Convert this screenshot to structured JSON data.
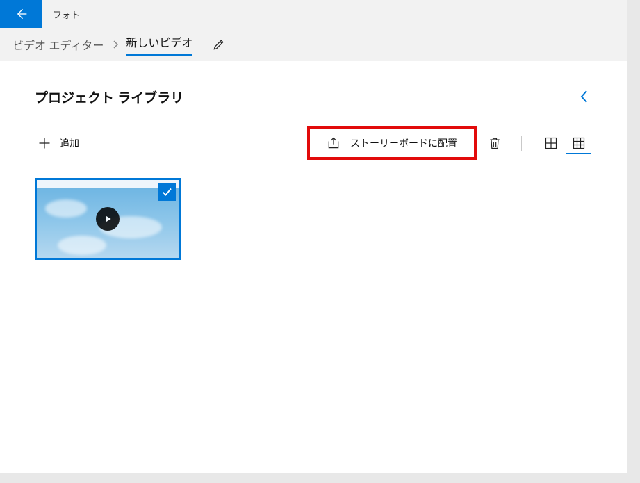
{
  "app": {
    "title": "フォト"
  },
  "breadcrumb": {
    "root": "ビデオ エディター",
    "current": "新しいビデオ"
  },
  "section": {
    "title": "プロジェクト ライブラリ"
  },
  "toolbar": {
    "add_label": "追加",
    "storyboard_label": "ストーリーボードに配置"
  },
  "library": {
    "items": [
      {
        "selected": true,
        "is_video": true
      }
    ]
  },
  "colors": {
    "accent": "#0078d7",
    "highlight_box": "#e20b0b"
  }
}
